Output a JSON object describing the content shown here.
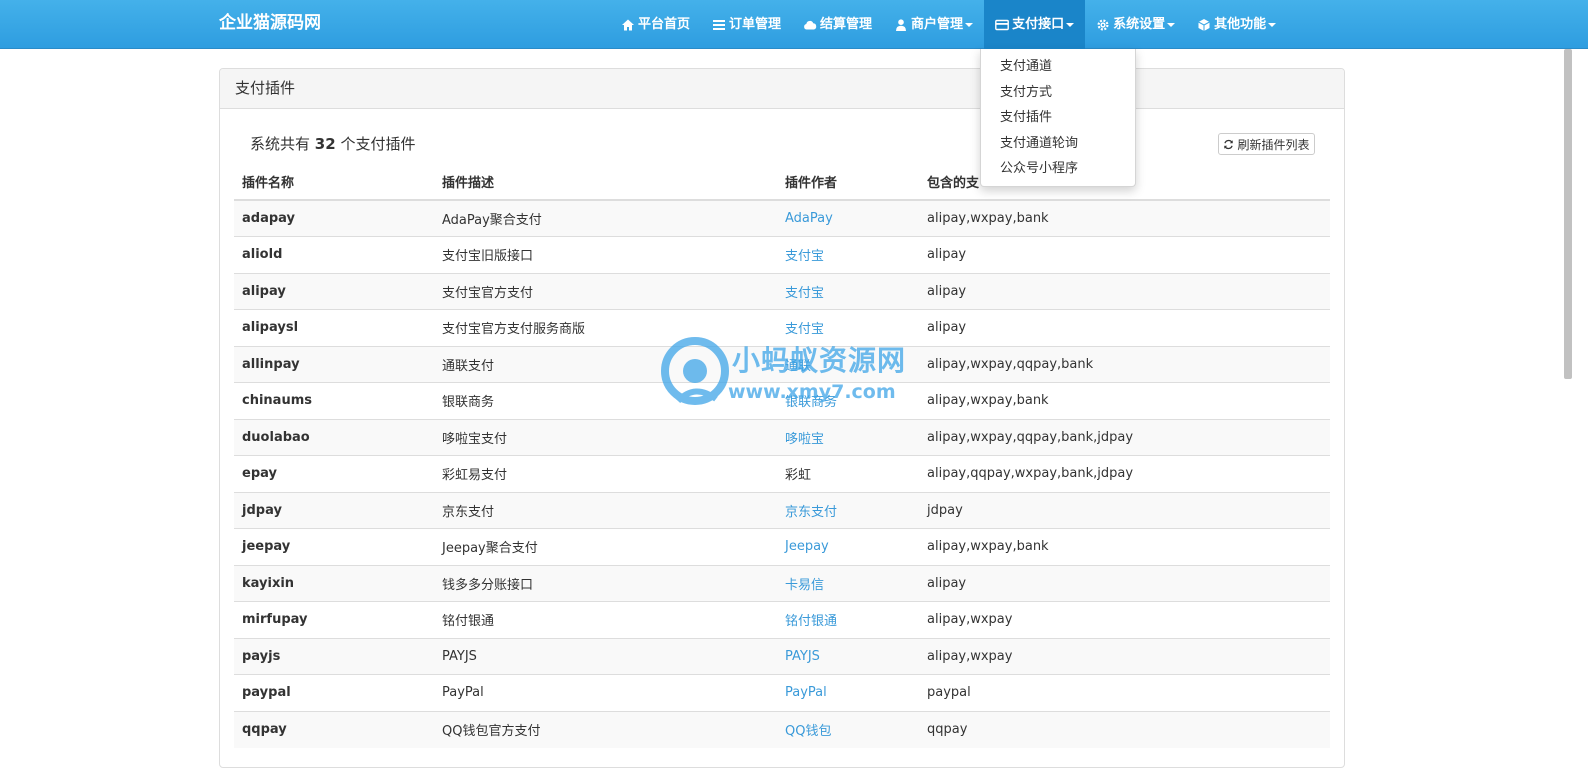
{
  "brand": "企业猫源码网",
  "nav": [
    {
      "label": "平台首页",
      "icon": "home-icon",
      "caret": false,
      "active": false
    },
    {
      "label": "订单管理",
      "icon": "list-icon",
      "caret": false,
      "active": false
    },
    {
      "label": "结算管理",
      "icon": "cloud-icon",
      "caret": false,
      "active": false
    },
    {
      "label": "商户管理",
      "icon": "user-icon",
      "caret": true,
      "active": false
    },
    {
      "label": "支付接口",
      "icon": "credit-card-icon",
      "caret": true,
      "active": true
    },
    {
      "label": "系统设置",
      "icon": "gear-icon",
      "caret": true,
      "active": false
    },
    {
      "label": "其他功能",
      "icon": "cube-icon",
      "caret": true,
      "active": false
    }
  ],
  "dropdown": [
    "支付通道",
    "支付方式",
    "支付插件",
    "支付通道轮询",
    "公众号小程序"
  ],
  "panel": {
    "title": "支付插件",
    "summary_prefix": "系统共有",
    "summary_count": "32",
    "summary_suffix": "个支付插件",
    "refresh_label": "刷新插件列表"
  },
  "table": {
    "headers": [
      "插件名称",
      "插件描述",
      "插件作者",
      "包含的支"
    ],
    "rows": [
      {
        "name": "adapay",
        "desc": "AdaPay聚合支付",
        "author": "AdaPay",
        "link": true,
        "types": "alipay,wxpay,bank"
      },
      {
        "name": "aliold",
        "desc": "支付宝旧版接口",
        "author": "支付宝",
        "link": true,
        "types": "alipay"
      },
      {
        "name": "alipay",
        "desc": "支付宝官方支付",
        "author": "支付宝",
        "link": true,
        "types": "alipay"
      },
      {
        "name": "alipaysl",
        "desc": "支付宝官方支付服务商版",
        "author": "支付宝",
        "link": true,
        "types": "alipay"
      },
      {
        "name": "allinpay",
        "desc": "通联支付",
        "author": "通联",
        "link": true,
        "types": "alipay,wxpay,qqpay,bank"
      },
      {
        "name": "chinaums",
        "desc": "银联商务",
        "author": "银联商务",
        "link": true,
        "types": "alipay,wxpay,bank"
      },
      {
        "name": "duolabao",
        "desc": "哆啦宝支付",
        "author": "哆啦宝",
        "link": true,
        "types": "alipay,wxpay,qqpay,bank,jdpay"
      },
      {
        "name": "epay",
        "desc": "彩虹易支付",
        "author": "彩虹",
        "link": false,
        "types": "alipay,qqpay,wxpay,bank,jdpay"
      },
      {
        "name": "jdpay",
        "desc": "京东支付",
        "author": "京东支付",
        "link": true,
        "types": "jdpay"
      },
      {
        "name": "jeepay",
        "desc": "Jeepay聚合支付",
        "author": "Jeepay",
        "link": true,
        "types": "alipay,wxpay,bank"
      },
      {
        "name": "kayixin",
        "desc": "钱多多分账接口",
        "author": "卡易信",
        "link": true,
        "types": "alipay"
      },
      {
        "name": "mirfupay",
        "desc": "铭付银通",
        "author": "铭付银通",
        "link": true,
        "types": "alipay,wxpay"
      },
      {
        "name": "payjs",
        "desc": "PAYJS",
        "author": "PAYJS",
        "link": true,
        "types": "alipay,wxpay"
      },
      {
        "name": "paypal",
        "desc": "PayPal",
        "author": "PayPal",
        "link": true,
        "types": "paypal"
      },
      {
        "name": "qqpay",
        "desc": "QQ钱包官方支付",
        "author": "QQ钱包",
        "link": true,
        "types": "qqpay"
      }
    ]
  },
  "watermark": {
    "title": "小蚂蚁资源网",
    "url": "www.xmy7.com"
  },
  "colors": {
    "navbar": "#3aa7e6",
    "navbar_active": "#1a85c9",
    "link": "#3a9ad9"
  }
}
